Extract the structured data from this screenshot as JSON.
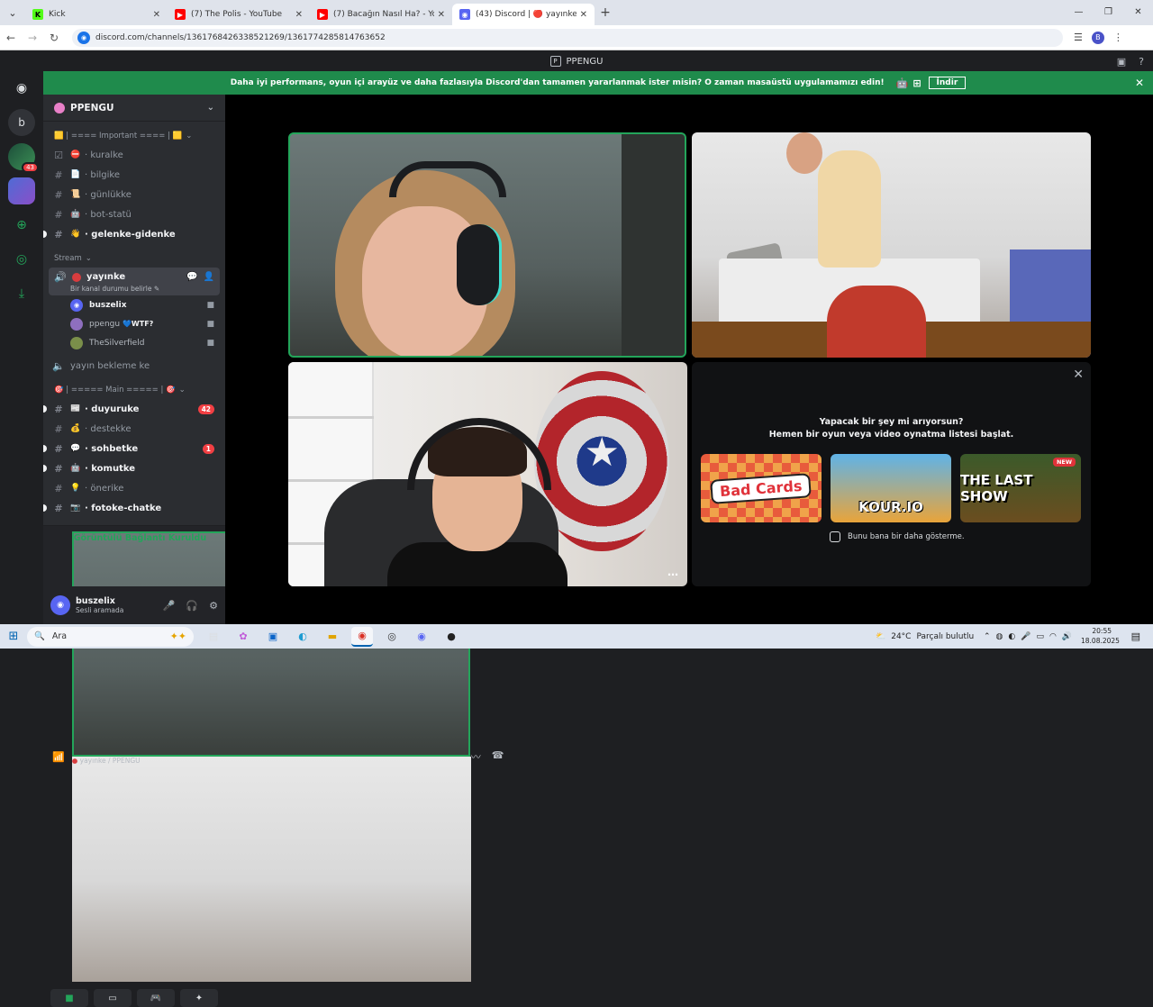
{
  "browser": {
    "tabs": [
      {
        "title": "Kick",
        "icon": "kick-icon",
        "color": "#53fc18",
        "active": false
      },
      {
        "title": "(7) The Polis - YouTube",
        "icon": "youtube-icon",
        "color": "#ff0000",
        "active": false
      },
      {
        "title": "(7) Bacağın Nasıl Ha? - YouTub",
        "icon": "youtube-icon",
        "color": "#ff0000",
        "active": false
      },
      {
        "title": "(43) Discord | 🔴 yayınke | ",
        "icon": "discord-icon",
        "color": "#5865f2",
        "active": true
      }
    ],
    "url": "discord.com/channels/1361768426338521269/1361774285814763652",
    "profile_initial": "B"
  },
  "discord_title": "PPENGU",
  "banner": {
    "text": "Daha iyi performans, oyun içi arayüz ve daha fazlasıyla Discord'dan tamamen yararlanmak ister misin? O zaman masaüstü uygulamamızı edin!",
    "download_label": "İndir"
  },
  "rail": {
    "badge": "43",
    "letter": "b"
  },
  "guild": {
    "name": "PPENGU",
    "cat_important": "🟨 | ==== Important ==== | 🟨",
    "channels_important": [
      {
        "emoji": "⛔",
        "name": "kuralke",
        "bold": false
      },
      {
        "emoji": "📄",
        "name": "bilgike",
        "bold": false
      },
      {
        "emoji": "📜",
        "name": "günlükke",
        "bold": false
      },
      {
        "emoji": "🤖",
        "name": "bot-statü",
        "bold": false
      },
      {
        "emoji": "👋",
        "name": "gelenke-gidenke",
        "bold": true
      }
    ],
    "cat_stream": "Stream",
    "voice_channel": {
      "name": "yayınke",
      "status_placeholder": "Bir kanal durumu belirle",
      "users": [
        {
          "name": "buszelix",
          "extra": "",
          "bold": true,
          "color": "#5865f2"
        },
        {
          "name": "ppengu",
          "extra": "💙WTF?",
          "bold": false,
          "color": "#8e6fbf"
        },
        {
          "name": "TheSilverfield",
          "extra": "",
          "bold": false,
          "color": "#7a8f4a"
        }
      ]
    },
    "waiting_channel": "yayın bekleme ke",
    "cat_main": "🎯 | ===== Main ===== | 🎯",
    "channels_main": [
      {
        "emoji": "📰",
        "name": "duyuruke",
        "bold": true,
        "count": "42"
      },
      {
        "emoji": "💰",
        "name": "destekke",
        "bold": false,
        "count": ""
      },
      {
        "emoji": "💬",
        "name": "sohbetke",
        "bold": true,
        "count": "1"
      },
      {
        "emoji": "🤖",
        "name": "komutke",
        "bold": true,
        "count": ""
      },
      {
        "emoji": "💡",
        "name": "önerike",
        "bold": false,
        "count": ""
      },
      {
        "emoji": "📷",
        "name": "fotoke-chatke",
        "bold": true,
        "count": ""
      }
    ]
  },
  "voice_panel": {
    "title": "Görüntülü Bağlantı Kuruldu",
    "subtitle": "yayınke / PPENGU"
  },
  "user": {
    "name": "buszelix",
    "status": "Sesli aramada"
  },
  "activity": {
    "line1": "Yapacak bir şey mi arıyorsun?",
    "line2": "Hemen bir oyun veya video oynatma listesi başlat.",
    "games": [
      {
        "title": "Bad Cards",
        "badge": ""
      },
      {
        "title": "KOUR.IO",
        "badge": ""
      },
      {
        "title": "THE LAST SHOW",
        "badge": "NEW"
      }
    ],
    "dont_show": "Bunu bana bir daha gösterme."
  },
  "taskbar": {
    "search_placeholder": "Ara",
    "weather_temp": "24°C",
    "weather_text": "Parçalı bulutlu",
    "time": "20:55",
    "date": "18.08.2025"
  }
}
